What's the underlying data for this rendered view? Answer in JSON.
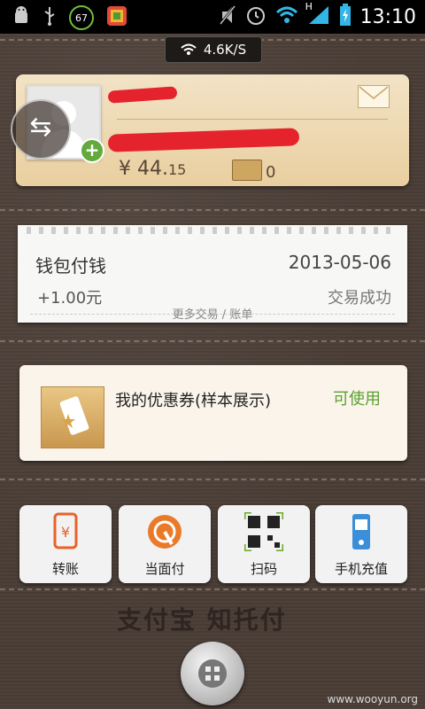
{
  "status_bar": {
    "battery_badge": "67",
    "time": "13:10",
    "network_type": "H"
  },
  "speed_indicator": {
    "value": "4.6K/S"
  },
  "account_card": {
    "balance_symbol": "¥",
    "balance_main": "44.",
    "balance_cents": "15",
    "card_count": "0"
  },
  "transaction": {
    "title": "钱包付钱",
    "date": "2013-05-06",
    "amount": "+1.00元",
    "status": "交易成功",
    "more_link": "更多交易 / 账单"
  },
  "coupon": {
    "title": "我的优惠券(样本展示)",
    "status": "可使用"
  },
  "actions": [
    {
      "label": "转账"
    },
    {
      "label": "当面付"
    },
    {
      "label": "扫码"
    },
    {
      "label": "手机充值"
    }
  ],
  "brand": {
    "logo_text": "支付宝 知托付"
  },
  "watermark": "www.wooyun.org",
  "colors": {
    "accent_green": "#5aa12f",
    "redaction_red": "#e5232c",
    "leather_brown": "#4a3d36",
    "card_tan": "#e9cfa0"
  },
  "icons": [
    "android-icon",
    "usb-icon",
    "gallery-icon",
    "mute-icon",
    "alarm-icon",
    "wifi-icon",
    "signal-icon",
    "battery-icon",
    "mail-icon",
    "card-icon",
    "swap-icon",
    "transfer-icon",
    "face-pay-icon",
    "qr-scan-icon",
    "phone-recharge-icon",
    "menu-grid-icon"
  ]
}
